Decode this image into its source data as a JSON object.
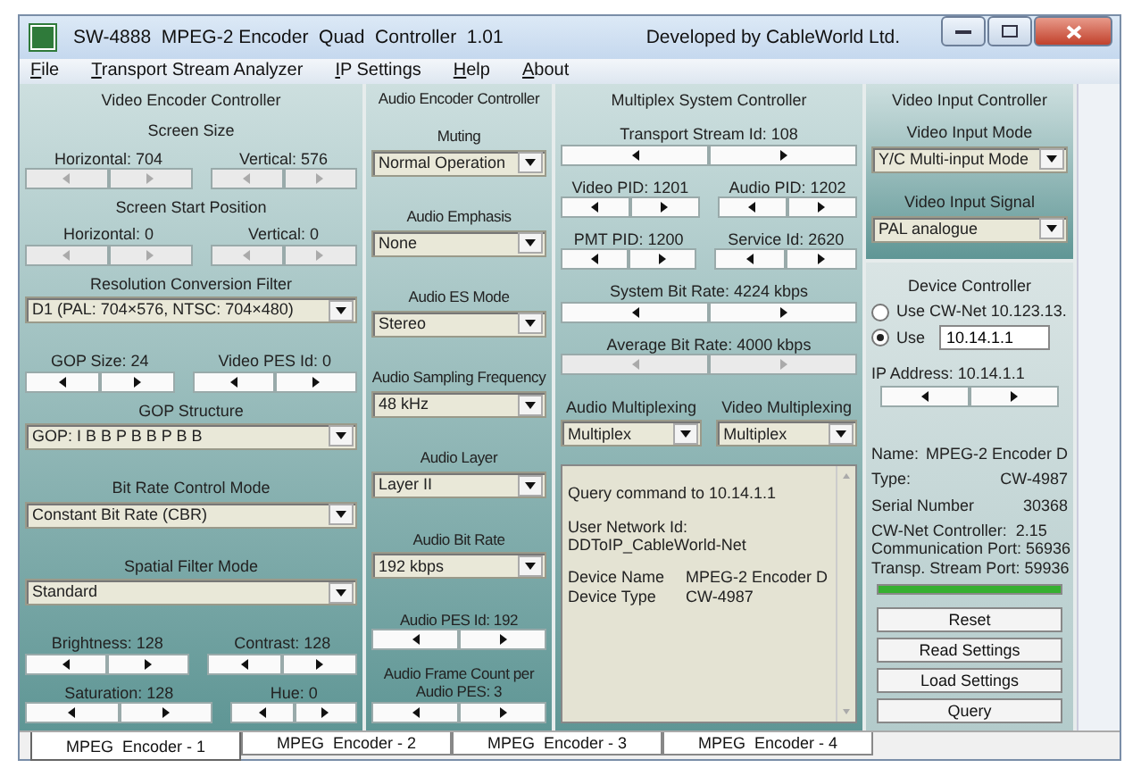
{
  "window": {
    "title": "SW-4888  MPEG-2 Encoder  Quad  Controller  1.01",
    "developer": "Developed by CableWorld Ltd."
  },
  "menu": [
    "File",
    "Transport Stream Analyzer",
    "IP Settings",
    "Help",
    "About"
  ],
  "video_encoder": {
    "title": "Video Encoder Controller",
    "items": [
      {
        "kind": "label",
        "text": "Screen Size"
      },
      {
        "kind": "spinners",
        "items": [
          {
            "label": "Horizontal: 704",
            "disabled": true
          },
          {
            "label": "Vertical: 576",
            "disabled": true
          }
        ]
      },
      {
        "kind": "label",
        "text": "Screen Start Position"
      },
      {
        "kind": "spinners",
        "items": [
          {
            "label": "Horizontal: 0",
            "disabled": true
          },
          {
            "label": "Vertical: 0",
            "disabled": true
          }
        ]
      },
      {
        "kind": "dropdown",
        "label": "Resolution Conversion Filter",
        "value": "D1 (PAL: 704×576, NTSC: 704×480)"
      },
      {
        "kind": "spinners",
        "items": [
          {
            "label": "GOP Size: 24",
            "disabled": false
          },
          {
            "label": "Video PES Id: 0",
            "disabled": false
          }
        ]
      },
      {
        "kind": "dropdown",
        "label": "GOP Structure",
        "value": "GOP:  I B B P B B P B B"
      },
      {
        "kind": "dropdown",
        "label": "Bit Rate Control Mode",
        "value": "Constant Bit Rate (CBR)"
      },
      {
        "kind": "dropdown",
        "label": "Spatial Filter Mode",
        "value": "Standard"
      },
      {
        "kind": "spinners",
        "items": [
          {
            "label": "Brightness: 128",
            "disabled": false
          },
          {
            "label": "Contrast: 128",
            "disabled": false
          }
        ]
      },
      {
        "kind": "spinners",
        "items": [
          {
            "label": "Saturation: 128",
            "disabled": false
          },
          {
            "label": "Hue: 0",
            "disabled": false
          }
        ]
      }
    ]
  },
  "audio_encoder": {
    "title": "Audio Encoder Controller",
    "items": [
      {
        "kind": "dropdown",
        "label": "Muting",
        "value": "Normal Operation"
      },
      {
        "kind": "dropdown",
        "label": "Audio Emphasis",
        "value": "None"
      },
      {
        "kind": "dropdown",
        "label": "Audio ES Mode",
        "value": "Stereo"
      },
      {
        "kind": "dropdown",
        "label": "Audio Sampling Frequency",
        "value": "48 kHz"
      },
      {
        "kind": "dropdown",
        "label": "Audio Layer",
        "value": "Layer II"
      },
      {
        "kind": "dropdown",
        "label": "Audio Bit Rate",
        "value": "192 kbps"
      },
      {
        "kind": "spinners",
        "items": [
          {
            "label": "Audio PES Id: 192",
            "disabled": false
          }
        ]
      },
      {
        "kind": "spinners",
        "items": [
          {
            "label": "Audio Frame Count per Audio PES: 3",
            "disabled": false
          }
        ]
      }
    ]
  },
  "multiplex": {
    "title": "Multiplex System Controller",
    "items": [
      {
        "kind": "spinners",
        "items": [
          {
            "label": "Transport Stream Id: 108",
            "disabled": false
          }
        ]
      },
      {
        "kind": "spinners",
        "items": [
          {
            "label": "Video PID: 1201",
            "disabled": false
          },
          {
            "label": "Audio PID: 1202",
            "disabled": false
          }
        ]
      },
      {
        "kind": "spinners",
        "items": [
          {
            "label": "PMT PID: 1200",
            "disabled": false
          },
          {
            "label": "Service Id: 2620",
            "disabled": false
          }
        ]
      },
      {
        "kind": "spinners",
        "items": [
          {
            "label": "System Bit Rate: 4224 kbps",
            "disabled": false
          }
        ]
      },
      {
        "kind": "spinners",
        "items": [
          {
            "label": "Average Bit Rate: 4000 kbps",
            "disabled": true
          }
        ]
      },
      {
        "kind": "dropdowns",
        "items": [
          {
            "label": "Audio Multiplexing",
            "value": "Multiplex"
          },
          {
            "label": "Video Multiplexing",
            "value": "Multiplex"
          }
        ]
      }
    ],
    "log": [
      {
        "lines": [
          {
            "text": "Query command to 10.14.1.1"
          }
        ]
      },
      {
        "lines": [
          {
            "text": "User Network Id:"
          },
          {
            "text": "DDToIP_CableWorld-Net"
          }
        ]
      },
      {
        "lines": [
          {
            "label": "Device Name",
            "value": "MPEG-2 Encoder D"
          },
          {
            "label": "Device Type",
            "value": "CW-4987"
          }
        ]
      }
    ]
  },
  "video_input": {
    "title": "Video Input Controller",
    "items": [
      {
        "kind": "dropdown",
        "label": "Video Input Mode",
        "value": "Y/C Multi-input Mode"
      },
      {
        "kind": "dropdown",
        "label": "Video Input Signal",
        "value": "PAL analogue"
      }
    ]
  },
  "device": {
    "title": "Device Controller",
    "radios": [
      {
        "label": "Use CW-Net 10.123.13.",
        "selected": false
      },
      {
        "label": "Use",
        "selected": true,
        "field": "10.14.1.1"
      }
    ],
    "ip": {
      "label": "IP Address: 10.14.1.1",
      "disabled": false
    },
    "info": [
      {
        "label": "Name:",
        "value": "MPEG-2 Encoder D"
      },
      {
        "label": "Type:",
        "value": "CW-4987"
      },
      {
        "label": "Serial Number",
        "value": "30368"
      }
    ],
    "status": [
      "CW-Net Controller:  2.15",
      "Communication Port: 56936",
      "Transp. Stream Port: 59936"
    ],
    "progress": {
      "level": 1
    },
    "buttons": [
      "Reset",
      "Read Settings",
      "Load Settings",
      "Query"
    ]
  },
  "tabs": [
    {
      "label": "MPEG  Encoder - 1",
      "selected": true
    },
    {
      "label": "MPEG  Encoder - 2",
      "selected": false
    },
    {
      "label": "MPEG  Encoder - 3",
      "selected": false
    },
    {
      "label": "MPEG  Encoder - 4",
      "selected": false
    }
  ]
}
